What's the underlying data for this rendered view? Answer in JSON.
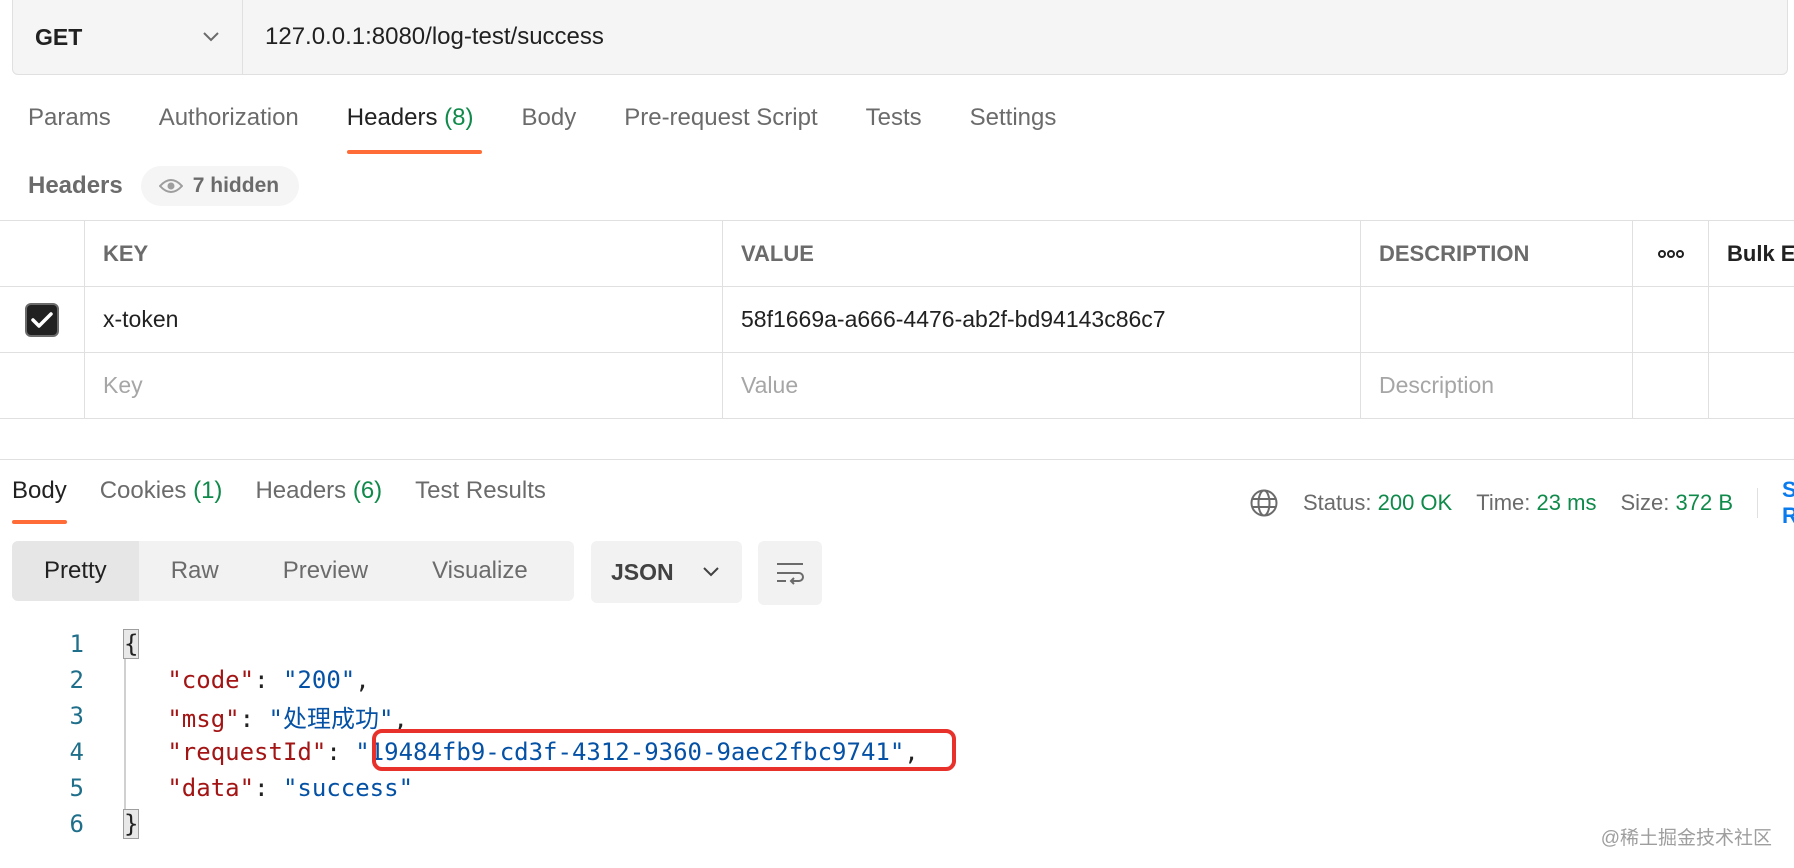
{
  "request": {
    "method": "GET",
    "url": "127.0.0.1:8080/log-test/success"
  },
  "request_tabs": [
    {
      "label": "Params"
    },
    {
      "label": "Authorization"
    },
    {
      "label": "Headers",
      "count": "(8)",
      "active": true
    },
    {
      "label": "Body"
    },
    {
      "label": "Pre-request Script"
    },
    {
      "label": "Tests"
    },
    {
      "label": "Settings"
    }
  ],
  "headers_section": {
    "label": "Headers",
    "hidden_label": "7 hidden"
  },
  "headers_table": {
    "columns": [
      "KEY",
      "VALUE",
      "DESCRIPTION",
      "Bulk Edit"
    ],
    "more_label": "ooo",
    "rows": [
      {
        "checked": true,
        "key": "x-token",
        "value": "58f1669a-a666-4476-ab2f-bd94143c86c7",
        "description": ""
      }
    ],
    "placeholders": {
      "key": "Key",
      "value": "Value",
      "description": "Description"
    }
  },
  "response_tabs": [
    {
      "label": "Body",
      "active": true
    },
    {
      "label": "Cookies",
      "count": "(1)"
    },
    {
      "label": "Headers",
      "count": "(6)"
    },
    {
      "label": "Test Results"
    }
  ],
  "status_bar": {
    "status_label": "Status:",
    "status_value": "200 OK",
    "time_label": "Time:",
    "time_value": "23 ms",
    "size_label": "Size:",
    "size_value": "372 B",
    "save_stub": "Save Response"
  },
  "view_modes": [
    {
      "label": "Pretty",
      "active": true
    },
    {
      "label": "Raw"
    },
    {
      "label": "Preview"
    },
    {
      "label": "Visualize"
    }
  ],
  "format_select": "JSON",
  "code_lines": [
    {
      "n": "1",
      "text": "{"
    },
    {
      "n": "2",
      "key": "\"code\"",
      "value": "\"200\"",
      "trail": ","
    },
    {
      "n": "3",
      "key": "\"msg\"",
      "value": "\"处理成功\"",
      "trail": ","
    },
    {
      "n": "4",
      "key": "\"requestId\"",
      "value": "\"19484fb9-cd3f-4312-9360-9aec2fbc9741\"",
      "trail": ","
    },
    {
      "n": "5",
      "key": "\"data\"",
      "value": "\"success\"",
      "trail": ""
    },
    {
      "n": "6",
      "text": "}"
    }
  ],
  "watermark": "@稀土掘金技术社区",
  "colors": {
    "accent": "#ff6c37",
    "success": "#0f8a4a",
    "highlight_box": "#e8312b",
    "json_key": "#a31515",
    "json_string": "#0451a5"
  }
}
